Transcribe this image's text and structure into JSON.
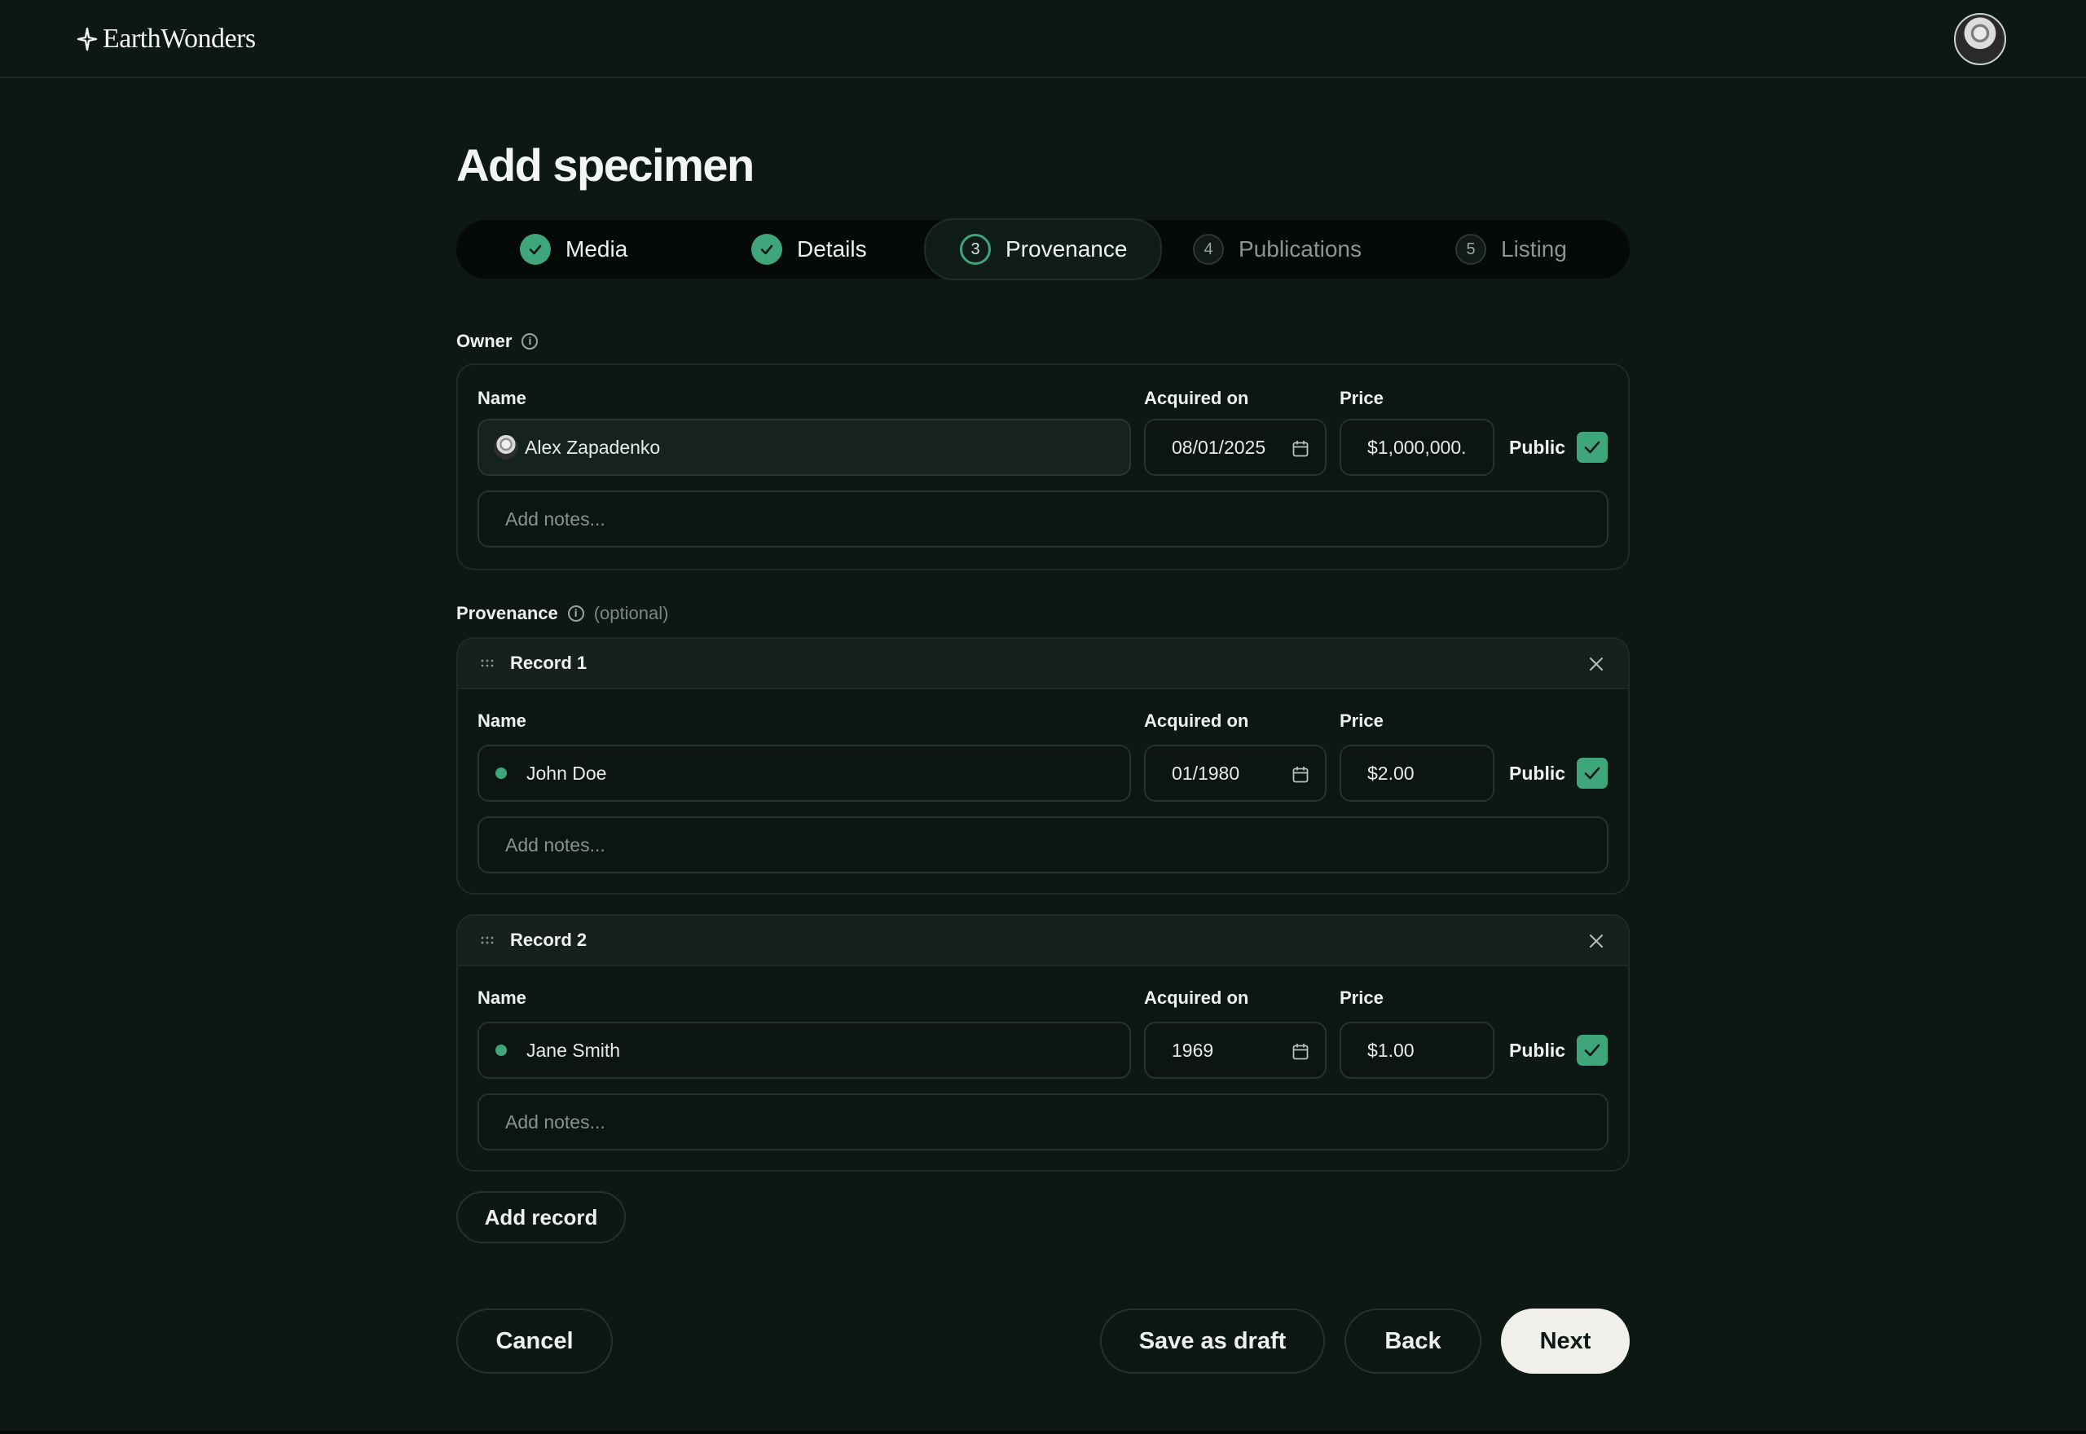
{
  "brand": {
    "name": "EarthWonders"
  },
  "page": {
    "title": "Add specimen"
  },
  "stepper": {
    "steps": [
      {
        "label": "Media",
        "state": "complete"
      },
      {
        "label": "Details",
        "state": "complete"
      },
      {
        "number": "3",
        "label": "Provenance",
        "state": "active"
      },
      {
        "number": "4",
        "label": "Publications",
        "state": "upcoming"
      },
      {
        "number": "5",
        "label": "Listing",
        "state": "upcoming"
      }
    ]
  },
  "owner": {
    "section_label": "Owner",
    "name_label": "Name",
    "acquired_label": "Acquired on",
    "price_label": "Price",
    "name": "Alex Zapadenko",
    "acquired_on": "08/01/2025",
    "price": "$1,000,000.",
    "public_label": "Public",
    "public_checked": true,
    "notes_placeholder": "Add notes..."
  },
  "provenance": {
    "section_label": "Provenance",
    "optional_label": "(optional)",
    "records": [
      {
        "title": "Record 1",
        "name_label": "Name",
        "acquired_label": "Acquired on",
        "price_label": "Price",
        "name": "John Doe",
        "acquired_on": "01/1980",
        "price": "$2.00",
        "public_label": "Public",
        "public_checked": true,
        "notes_placeholder": "Add notes..."
      },
      {
        "title": "Record 2",
        "name_label": "Name",
        "acquired_label": "Acquired on",
        "price_label": "Price",
        "name": "Jane Smith",
        "acquired_on": "1969",
        "price": "$1.00",
        "public_label": "Public",
        "public_checked": true,
        "notes_placeholder": "Add notes..."
      }
    ],
    "add_record_label": "Add record"
  },
  "actions": {
    "cancel_label": "Cancel",
    "save_draft_label": "Save as draft",
    "back_label": "Back",
    "next_label": "Next"
  },
  "colors": {
    "background": "#0d1714",
    "accent": "#3fa67c",
    "primary_button": "#f1efea"
  }
}
